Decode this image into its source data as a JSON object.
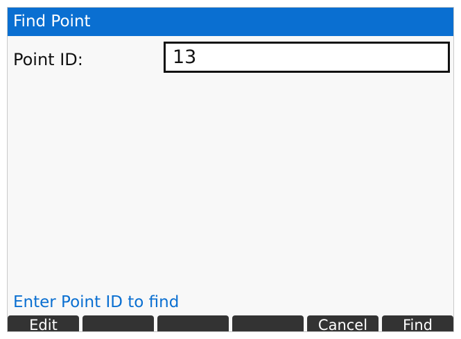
{
  "window": {
    "title": "Find Point"
  },
  "form": {
    "point_id_label": "Point ID:",
    "point_id_value": "13"
  },
  "status": {
    "hint": "Enter Point ID to find"
  },
  "softkeys": [
    {
      "label": "Edit"
    },
    {
      "label": ""
    },
    {
      "label": ""
    },
    {
      "label": ""
    },
    {
      "label": "Cancel"
    },
    {
      "label": "Find"
    }
  ]
}
